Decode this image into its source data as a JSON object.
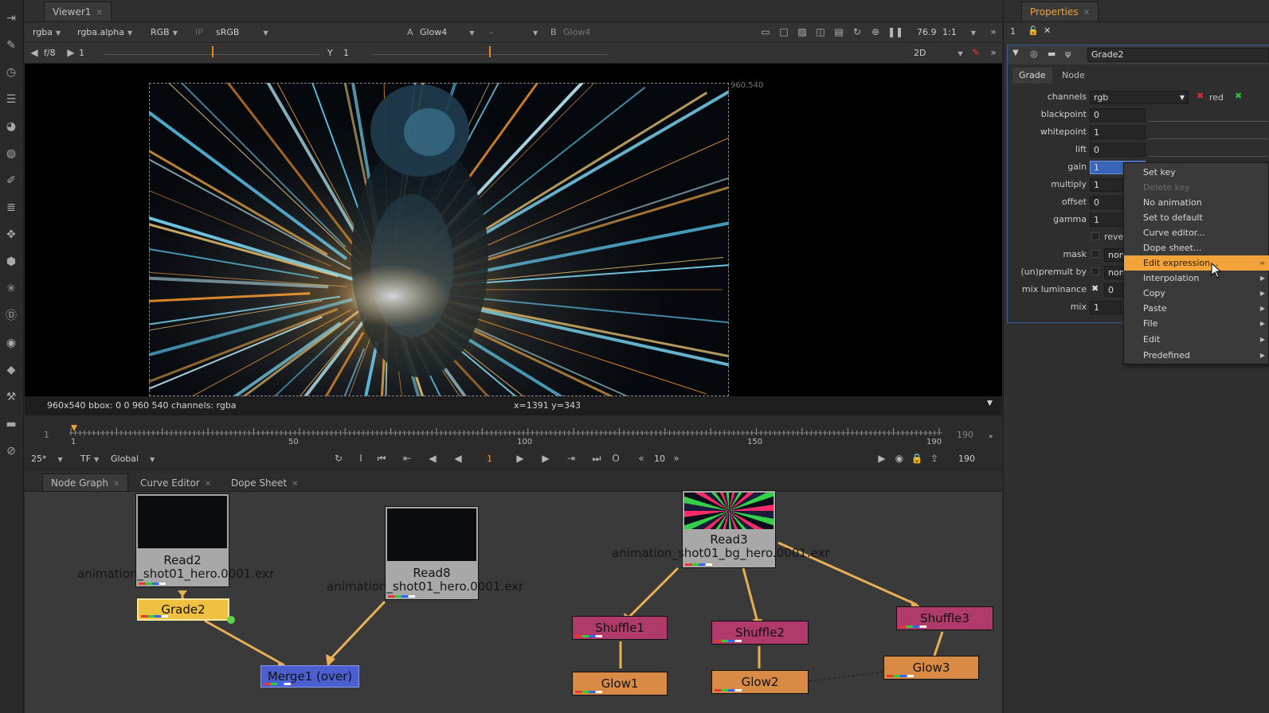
{
  "viewer": {
    "tab_label": "Viewer1",
    "channels": "rgba",
    "alpha": "rgba.alpha",
    "colorspace_mode": "RGB",
    "ip": "IP",
    "lut": "sRGB",
    "input_a_label": "A",
    "input_a": "Glow4",
    "dash": "-",
    "input_b_label": "B",
    "input_b": "Glow4",
    "zoom": "76.9",
    "ratio": "1:1",
    "fstop": "f/8",
    "gain_value": "1",
    "y_label": "Y",
    "gamma_value": "1",
    "view_mode": "2D",
    "format_corner": "960,540",
    "info_left": "960x540  bbox: 0 0 960 540 channels: rgba",
    "info_cursor": "x=1391 y=343"
  },
  "timeline": {
    "start": "1",
    "end": "190",
    "ticks": [
      "1",
      "50",
      "100",
      "150",
      "190"
    ],
    "fps": "25*",
    "tf": "TF",
    "global": "Global",
    "current_frame": "1",
    "increment": "10",
    "end_field": "190"
  },
  "panels": {
    "node_graph": "Node Graph",
    "curve_editor": "Curve Editor",
    "dope_sheet": "Dope Sheet"
  },
  "nodes": {
    "read2": {
      "name": "Read2",
      "file": "animation_shot01_hero.0001.exr"
    },
    "read8": {
      "name": "Read8",
      "file": "animation_shot01_hero.0001.exr"
    },
    "read3": {
      "name": "Read3",
      "file": "animation_shot01_bg_hero.0001.exr"
    },
    "grade2": "Grade2",
    "merge1": "Merge1 (over)",
    "shuffle1": "Shuffle1",
    "shuffle2": "Shuffle2",
    "shuffle3": "Shuffle3",
    "glow1": "Glow1",
    "glow2": "Glow2",
    "glow3": "Glow3"
  },
  "properties": {
    "tab_label": "Properties",
    "node_name": "Grade2",
    "tabs": [
      "Grade",
      "Node"
    ],
    "count": "1",
    "params": [
      {
        "label": "channels",
        "value": "rgb"
      },
      {
        "label": "blackpoint",
        "value": "0"
      },
      {
        "label": "whitepoint",
        "value": "1"
      },
      {
        "label": "lift",
        "value": "0"
      },
      {
        "label": "gain",
        "value": "1"
      },
      {
        "label": "multiply",
        "value": "1"
      },
      {
        "label": "offset",
        "value": "0"
      },
      {
        "label": "gamma",
        "value": "1"
      },
      {
        "label": "",
        "value": "reve"
      },
      {
        "label": "mask",
        "value": "non"
      },
      {
        "label": "(un)premult by",
        "value": "non"
      },
      {
        "label": "mix luminance",
        "value": "0"
      },
      {
        "label": "mix",
        "value": "1"
      }
    ],
    "channel_red": "red"
  },
  "context_menu": [
    {
      "label": "Set key",
      "state": "normal",
      "submenu": false
    },
    {
      "label": "Delete key",
      "state": "disabled",
      "submenu": false
    },
    {
      "label": "No animation",
      "state": "normal",
      "submenu": false
    },
    {
      "label": "Set to default",
      "state": "normal",
      "submenu": false
    },
    {
      "label": "Curve editor...",
      "state": "normal",
      "submenu": false
    },
    {
      "label": "Dope sheet...",
      "state": "normal",
      "submenu": false
    },
    {
      "label": "Edit expression...",
      "state": "highlighted",
      "submenu": false
    },
    {
      "label": "Interpolation",
      "state": "normal",
      "submenu": true
    },
    {
      "label": "Copy",
      "state": "normal",
      "submenu": true
    },
    {
      "label": "Paste",
      "state": "normal",
      "submenu": true
    },
    {
      "label": "File",
      "state": "normal",
      "submenu": true
    },
    {
      "label": "Edit",
      "state": "normal",
      "submenu": true
    },
    {
      "label": "Predefined",
      "state": "normal",
      "submenu": true
    }
  ],
  "colors": {
    "accent": "#f2a33a",
    "read_node": "#a8a8a8",
    "grade_node": "#f0c040",
    "merge_node": "#4b5fd0",
    "shuffle_node": "#b03a6a",
    "glow_node": "#d98a45",
    "edge": "#e8b056"
  }
}
